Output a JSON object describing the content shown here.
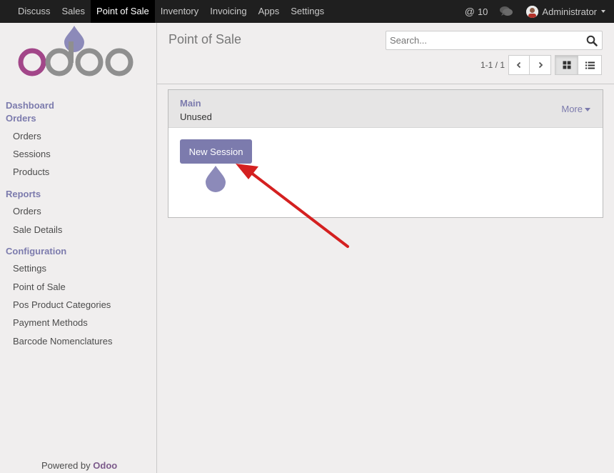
{
  "topbar": {
    "menu": [
      "Discuss",
      "Sales",
      "Point of Sale",
      "Inventory",
      "Invoicing",
      "Apps",
      "Settings"
    ],
    "active_index": 2,
    "mentions_count": "10",
    "user_name": "Administrator"
  },
  "sidebar": {
    "sections": [
      {
        "label": "Dashboard"
      },
      {
        "label": "Orders",
        "items": [
          "Orders",
          "Sessions",
          "Products"
        ]
      },
      {
        "label": "Reports",
        "items": [
          "Orders",
          "Sale Details"
        ]
      },
      {
        "label": "Configuration",
        "items": [
          "Settings",
          "Point of Sale",
          "Pos Product Categories",
          "Payment Methods",
          "Barcode Nomenclatures"
        ]
      }
    ],
    "powered_prefix": "Powered by",
    "powered_brand": "Odoo"
  },
  "control_panel": {
    "title": "Point of Sale",
    "search_placeholder": "Search...",
    "pager": "1-1 / 1"
  },
  "card": {
    "name": "Main",
    "status": "Unused",
    "more_label": "More",
    "new_session_label": "New Session"
  },
  "colors": {
    "brand": "#7c7bad",
    "topbar": "#1f1f1f",
    "annotation_arrow": "#d42020"
  }
}
